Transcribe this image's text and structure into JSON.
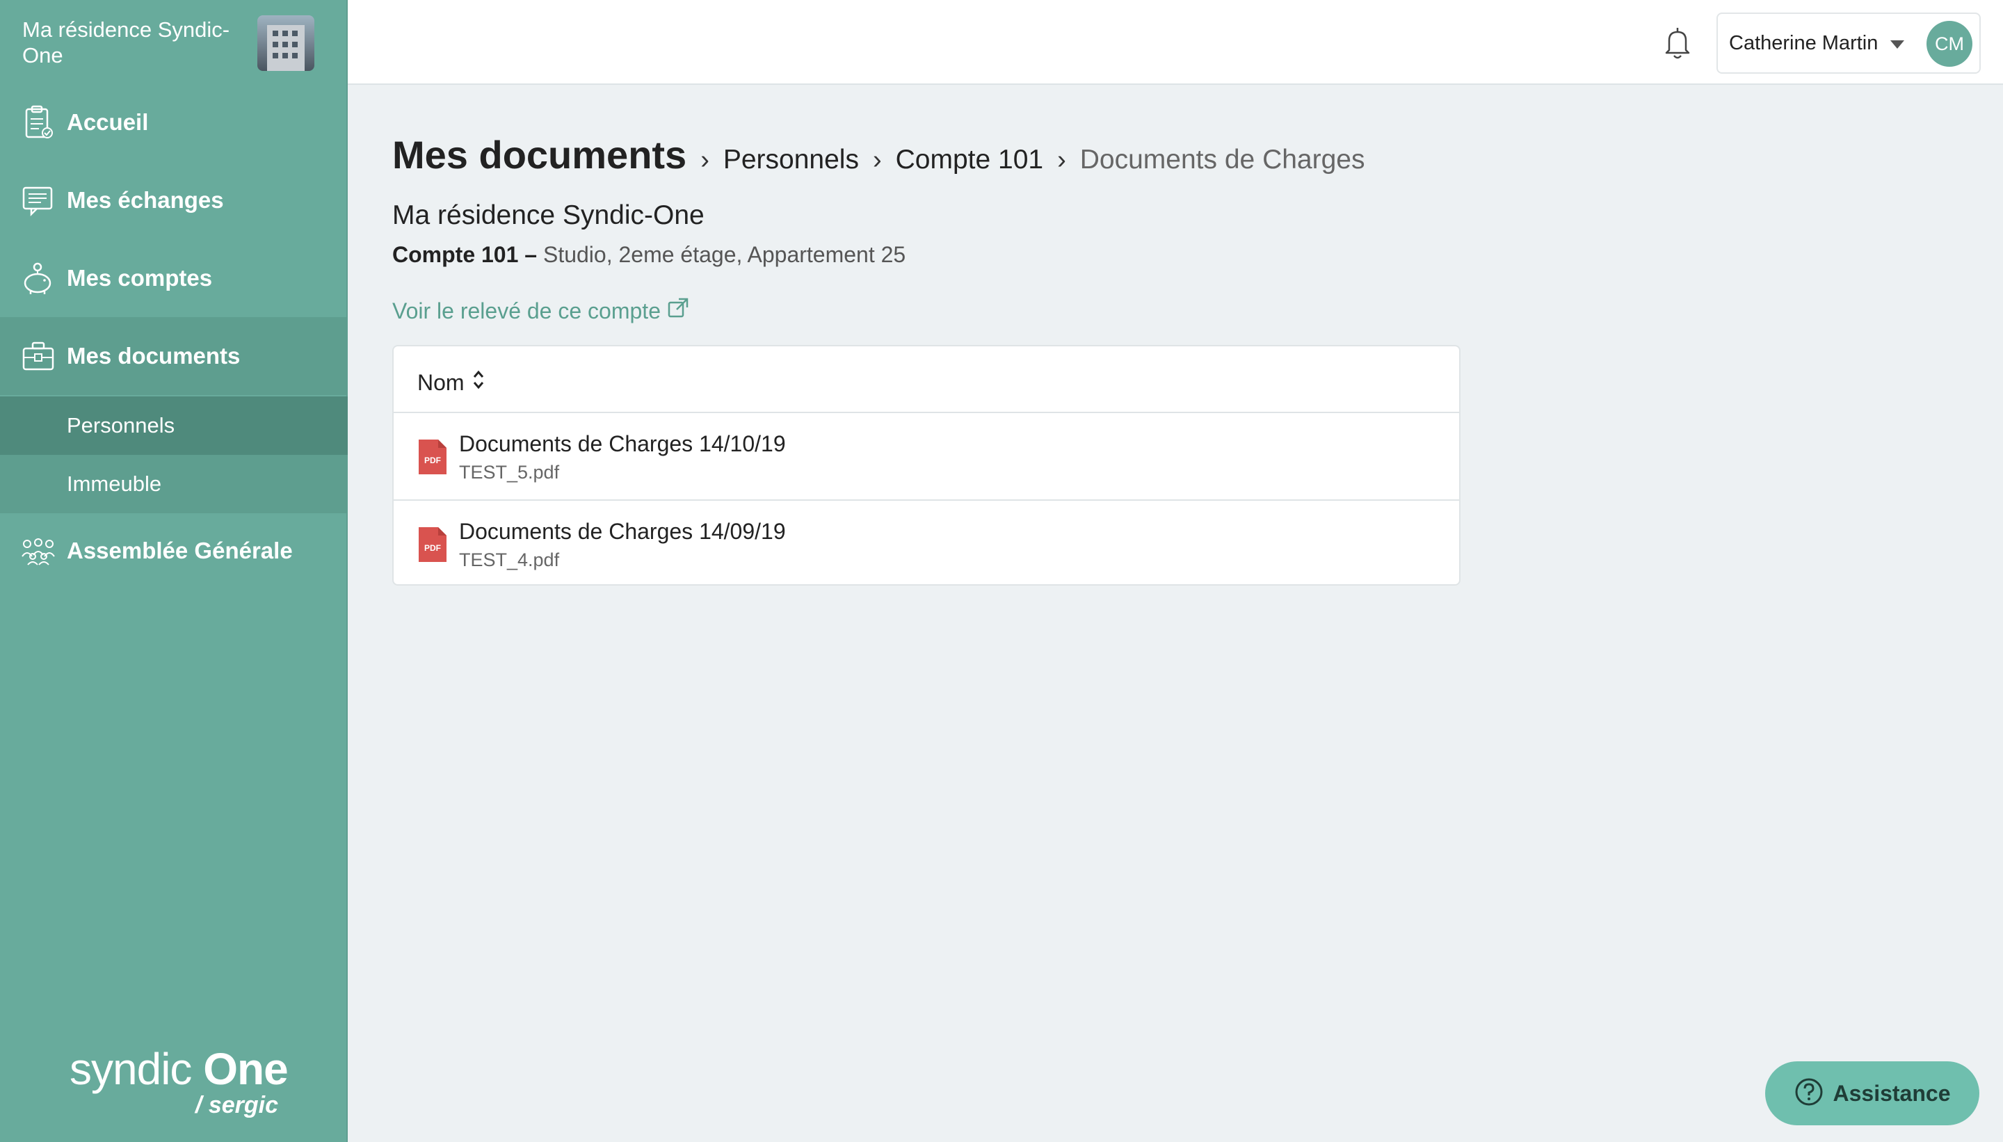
{
  "sidebar": {
    "residence_name": "Ma résidence Syndic-One",
    "items": [
      {
        "label": "Accueil",
        "icon": "clipboard-icon"
      },
      {
        "label": "Mes échanges",
        "icon": "chat-icon"
      },
      {
        "label": "Mes comptes",
        "icon": "piggy-bank-icon"
      },
      {
        "label": "Mes documents",
        "icon": "briefcase-icon",
        "active": true
      },
      {
        "label": "Assemblée Générale",
        "icon": "group-icon"
      }
    ],
    "sub_items": [
      {
        "label": "Personnels",
        "active": true
      },
      {
        "label": "Immeuble"
      }
    ],
    "brand": {
      "main_light": "syndic ",
      "main_bold": "One",
      "sub": "/ sergic"
    }
  },
  "topbar": {
    "user_name": "Catherine Martin",
    "avatar_initials": "CM"
  },
  "main": {
    "breadcrumb": {
      "title": "Mes documents",
      "links": [
        "Personnels",
        "Compte 101"
      ],
      "current": "Documents de Charges",
      "separator": "›"
    },
    "residence": "Ma résidence Syndic-One",
    "account_label": "Compte 101 –",
    "account_detail": "Studio, 2eme étage, Appartement 25",
    "releve_link": "Voir le relevé de ce compte",
    "table": {
      "column_header": "Nom",
      "rows": [
        {
          "title": "Documents de Charges 14/10/19",
          "file": "TEST_5.pdf"
        },
        {
          "title": "Documents de Charges 14/09/19",
          "file": "TEST_4.pdf"
        }
      ]
    }
  },
  "assistance": {
    "label": "Assistance"
  },
  "colors": {
    "sidebar": "#68ab9c",
    "sidebar_active": "#5e9e8f",
    "accent_link": "#5a9f8f",
    "pdf_red": "#d9534f",
    "assistance": "#6fbfae"
  }
}
